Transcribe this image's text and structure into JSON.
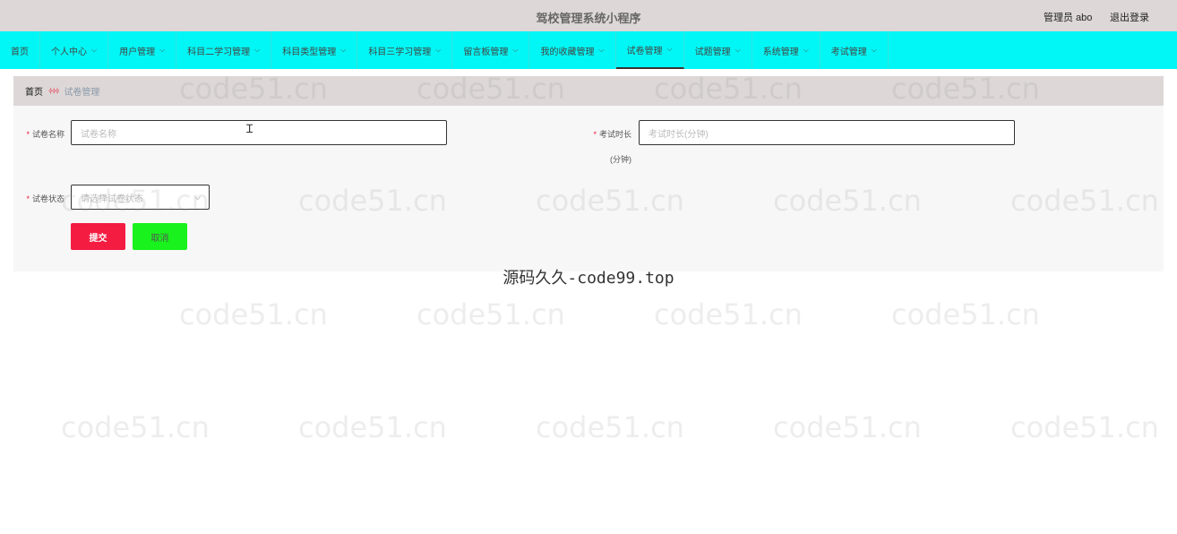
{
  "header": {
    "app_title": "驾校管理系统小程序",
    "user_label": "管理员 abo",
    "logout_label": "退出登录"
  },
  "nav": {
    "items": [
      {
        "label": "首页"
      },
      {
        "label": "个人中心"
      },
      {
        "label": "用户管理"
      },
      {
        "label": "科目二学习管理"
      },
      {
        "label": "科目类型管理"
      },
      {
        "label": "科目三学习管理"
      },
      {
        "label": "留言板管理"
      },
      {
        "label": "我的收藏管理"
      },
      {
        "label": "试卷管理"
      },
      {
        "label": "试题管理"
      },
      {
        "label": "系统管理"
      },
      {
        "label": "考试管理"
      }
    ],
    "active": "试卷管理"
  },
  "breadcrumb": {
    "home": "首页",
    "separator": "ᛄᛄᛄ",
    "current": "试卷管理"
  },
  "form": {
    "name_label": "试卷名称",
    "name_placeholder": "试卷名称",
    "duration_label": "考试时长",
    "duration_unit": "(分钟)",
    "duration_placeholder": "考试时长(分钟)",
    "status_label": "试卷状态",
    "status_placeholder": "请选择试卷状态",
    "submit_label": "提交",
    "cancel_label": "取消"
  },
  "footer": {
    "text": "源码久久-code99.top"
  },
  "watermark": {
    "text": "code51.cn"
  },
  "colors": {
    "nav_bg": "#00f7f5",
    "header_bg": "#ddd7d7",
    "submit_bg": "#f41c41",
    "cancel_bg": "#19f21c",
    "required": "#e8203a"
  }
}
